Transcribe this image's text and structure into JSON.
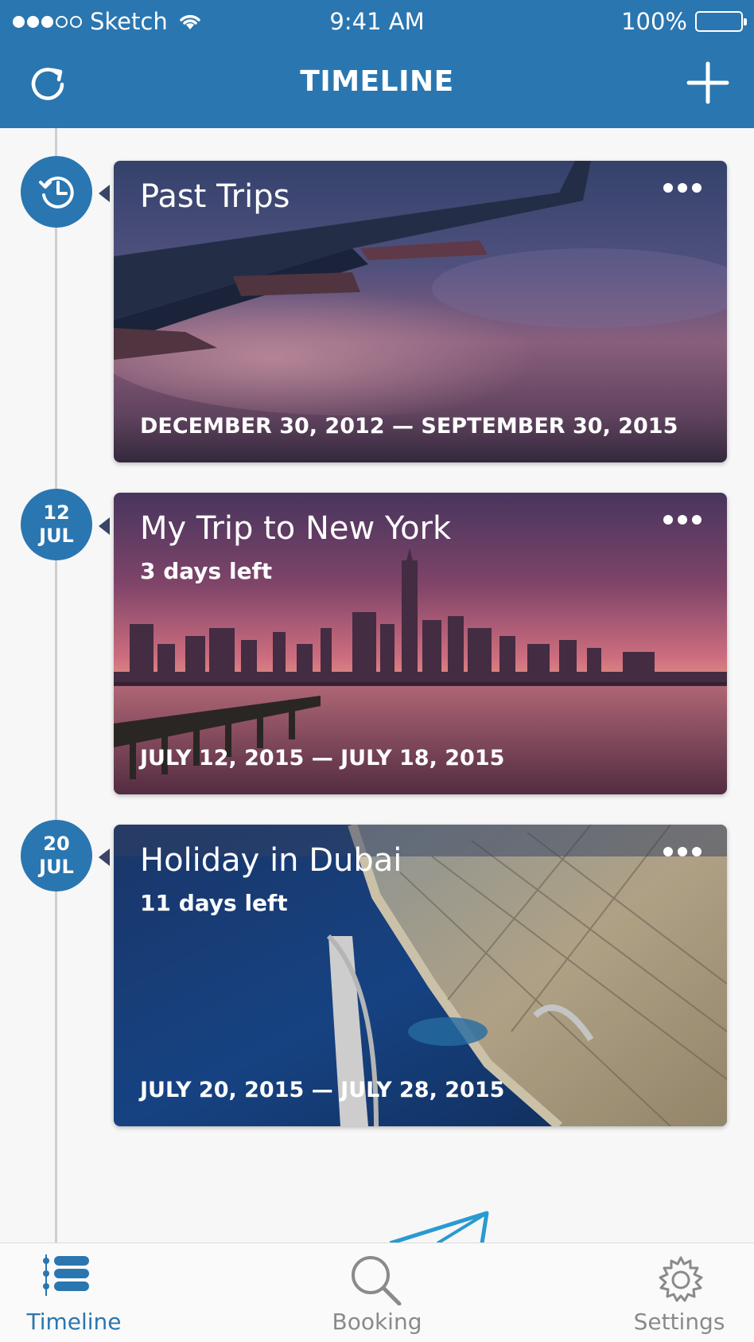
{
  "status_bar": {
    "carrier": "Sketch",
    "time": "9:41 AM",
    "battery": "100%"
  },
  "nav": {
    "title": "TIMELINE",
    "left_icon": "refresh-icon",
    "right_icon": "plus-icon"
  },
  "colors": {
    "primary": "#2a76b0",
    "background": "#f7f7f7"
  },
  "timeline": [
    {
      "marker_icon": "history-icon",
      "title": "Past Trips",
      "days_left": "",
      "dates": "DECEMBER 30, 2012 — SEPTEMBER 30, 2015"
    },
    {
      "marker_day": "12",
      "marker_month": "JUL",
      "title": "My Trip to New York",
      "days_left": "3 days left",
      "dates": "JULY 12, 2015 — JULY 18, 2015"
    },
    {
      "marker_day": "20",
      "marker_month": "JUL",
      "title": "Holiday in Dubai",
      "days_left": "11 days left",
      "dates": "JULY 20, 2015 — JULY 28, 2015"
    }
  ],
  "tabs": [
    {
      "label": "Timeline",
      "icon": "list-icon",
      "active": true
    },
    {
      "label": "Booking",
      "icon": "search-icon",
      "active": false
    },
    {
      "label": "Settings",
      "icon": "gear-icon",
      "active": false
    }
  ]
}
